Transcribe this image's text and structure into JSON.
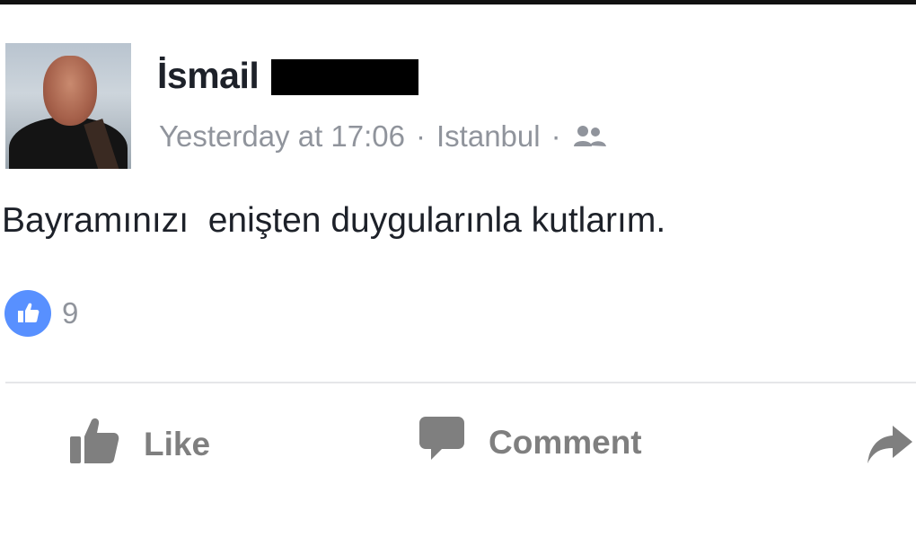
{
  "post": {
    "author": "İsmail",
    "timestamp": "Yesterday at 17:06",
    "location": "Istanbul",
    "separator": "·",
    "audience_icon": "friends-icon",
    "text": "Bayramınızı  enişten duygularınla kutlarım.",
    "like_count": "9"
  },
  "actions": {
    "like_label": "Like",
    "comment_label": "Comment",
    "share_icon": "share-arrow-icon"
  },
  "colors": {
    "text": "#1d2129",
    "meta": "#90949c",
    "like_blue": "#5890ff",
    "action_gray": "#7f7f7f",
    "divider": "#e5e6e9"
  }
}
